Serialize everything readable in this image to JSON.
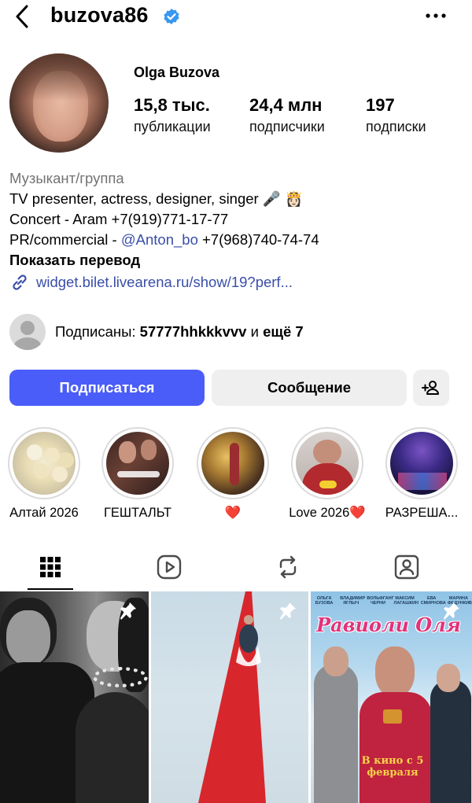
{
  "header": {
    "username": "buzova86",
    "back_icon": "chevron-left-icon",
    "verified_icon": "verified-badge-icon",
    "more_icon": "more-horizontal-icon"
  },
  "profile": {
    "name": "Olga Buzova",
    "stats": [
      {
        "value": "15,8 тыс.",
        "label": "публикации"
      },
      {
        "value": "24,4 млн",
        "label": "подписчики"
      },
      {
        "value": "197",
        "label": "подписки"
      }
    ]
  },
  "bio": {
    "category": "Музыкант/группа",
    "line1": "TV presenter, actress, designer, singer 🎤 👸🏻",
    "line2": "Concert - Aram +7(919)771-17-77",
    "line3_prefix": "PR/commercial - ",
    "line3_mention": "@Anton_bo",
    "line3_suffix": " +7(968)740-74-74",
    "translate": "Показать перевод",
    "link": "widget.bilet.livearena.ru/show/19?perf..."
  },
  "followed_by": {
    "prefix": "Подписаны: ",
    "user": "57777hhkkkvvv",
    "middle": " и ",
    "others": "ещё 7"
  },
  "actions": {
    "follow_label": "Подписаться",
    "message_label": "Сообщение",
    "add_icon": "person-add-icon",
    "follow_color": "#4a5df9"
  },
  "highlights": [
    {
      "label": "Алтай 2026"
    },
    {
      "label": "ГЕШТАЛЬТ"
    },
    {
      "label": "❤️"
    },
    {
      "label": "Love 2026❤️"
    },
    {
      "label": "РАЗРЕША..."
    }
  ],
  "tabs": [
    {
      "icon": "grid-icon",
      "active": true
    },
    {
      "icon": "reels-icon",
      "active": false
    },
    {
      "icon": "reposts-icon",
      "active": false
    },
    {
      "icon": "tagged-icon",
      "active": false
    }
  ],
  "posts": [
    {
      "pinned": true,
      "pin_icon": "pin-icon"
    },
    {
      "pinned": true,
      "pin_icon": "pin-icon"
    },
    {
      "pinned": true,
      "pin_icon": "pin-icon",
      "poster_title": "Равиоли Оля",
      "poster_cast": [
        "ОЛЬГА БУЗОВА",
        "ВЛАДИМИР ЯГЛЫЧ",
        "ВОЛЬФГАНГ ЧЕРНИ",
        "МАКСИМ ЛАГАШКИН",
        "ЕВА СМИРНОВА",
        "МАРИНА ФЕДУНКИВ"
      ],
      "poster_tagline": "В кино с 5 февраля"
    }
  ]
}
